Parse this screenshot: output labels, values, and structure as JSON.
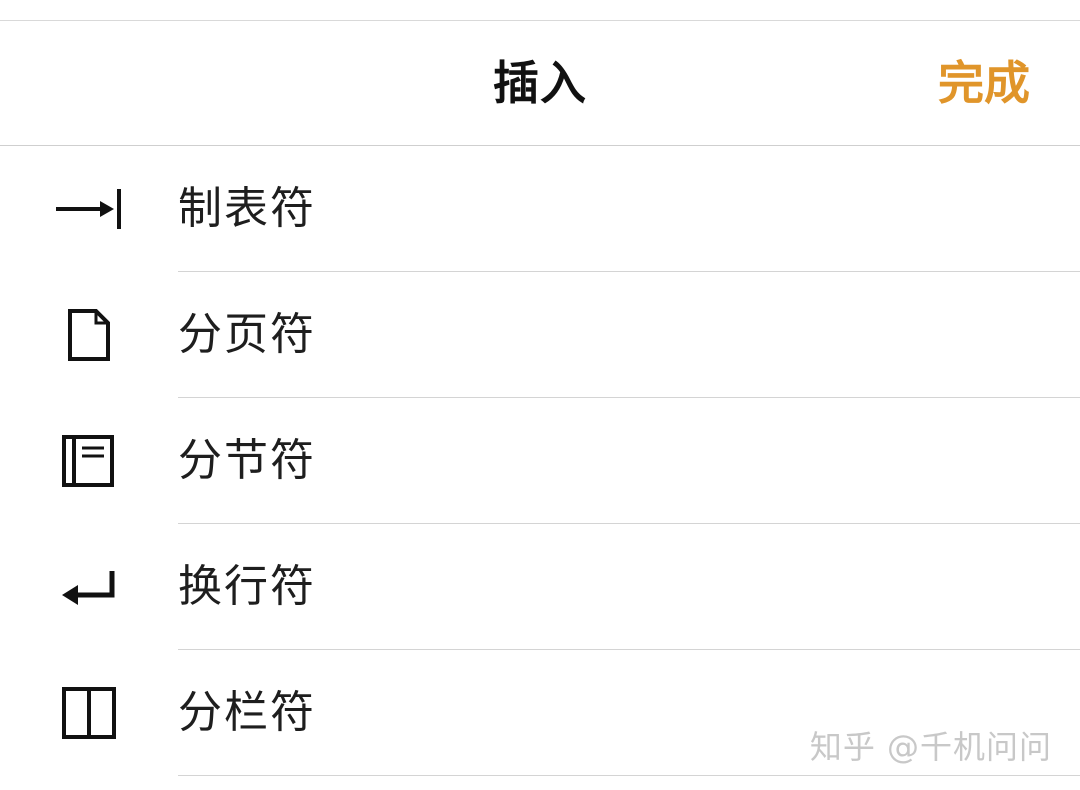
{
  "header": {
    "title": "插入",
    "done_label": "完成",
    "accent_color": "#e0952a"
  },
  "items": [
    {
      "icon": "tab-stop-icon",
      "label": "制表符"
    },
    {
      "icon": "page-break-icon",
      "label": "分页符"
    },
    {
      "icon": "section-break-icon",
      "label": "分节符"
    },
    {
      "icon": "line-break-icon",
      "label": "换行符"
    },
    {
      "icon": "column-break-icon",
      "label": "分栏符"
    }
  ],
  "watermark": "知乎 @千机问问"
}
